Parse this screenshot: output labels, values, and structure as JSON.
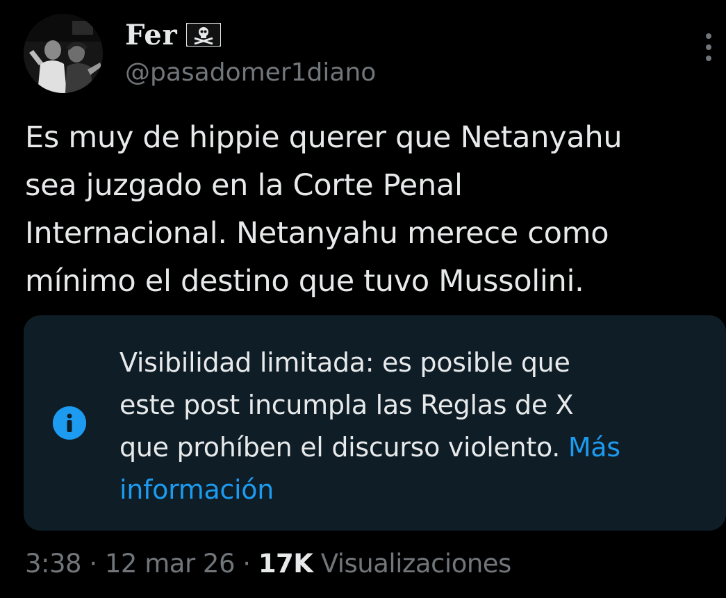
{
  "author": {
    "display_name": "Fer",
    "handle": "@pasadomer1diano",
    "flag_icon": "pirate-flag-icon"
  },
  "tweet": {
    "lines": [
      "Es muy de hippie querer que Netanyahu",
      "sea juzgado en la Corte Penal",
      "Internacional. Netanyahu merece como",
      "mínimo el destino que tuvo Mussolini."
    ]
  },
  "notice": {
    "icon": "info-icon",
    "lines": [
      "Visibilidad limitada: es posible que",
      "este post incumpla las Reglas de X",
      "que prohíben el discurso violento. "
    ],
    "link_part1": "Más",
    "link_part2": "información"
  },
  "meta": {
    "time": "3:38",
    "sep1": " · ",
    "date": "12 mar 26",
    "sep2": " · ",
    "views_count": "17K",
    "views_label": " Visualizaciones"
  },
  "colors": {
    "background": "#000000",
    "text": "#e7e9ea",
    "secondary": "#71767b",
    "accent": "#1d9bf0",
    "notice_bg": "#0e1d26"
  }
}
